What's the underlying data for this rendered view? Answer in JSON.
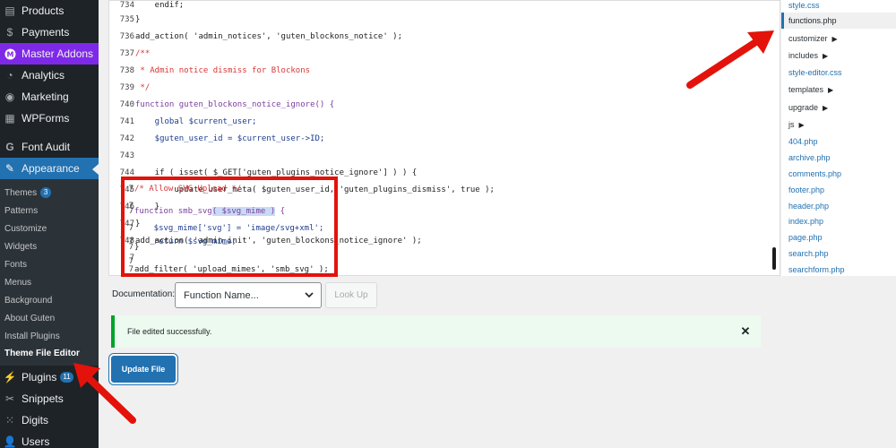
{
  "sidebar": {
    "top_items": [
      {
        "label": "Products",
        "icon": "products-icon"
      },
      {
        "label": "Payments",
        "icon": "payments-icon"
      },
      {
        "label": "Master Addons",
        "icon": "master-addons-icon"
      },
      {
        "label": "Analytics",
        "icon": "analytics-icon"
      },
      {
        "label": "Marketing",
        "icon": "marketing-icon"
      },
      {
        "label": "WPForms",
        "icon": "wpforms-icon"
      },
      {
        "label": "Font Audit",
        "icon": "font-audit-icon"
      },
      {
        "label": "Appearance",
        "icon": "appearance-icon"
      }
    ],
    "appearance_sub": [
      {
        "label": "Themes",
        "badge": "3"
      },
      {
        "label": "Patterns"
      },
      {
        "label": "Customize"
      },
      {
        "label": "Widgets"
      },
      {
        "label": "Fonts"
      },
      {
        "label": "Menus"
      },
      {
        "label": "Background"
      },
      {
        "label": "About Guten"
      },
      {
        "label": "Install Plugins"
      },
      {
        "label": "Theme File Editor"
      }
    ],
    "bottom_items": [
      {
        "label": "Plugins",
        "icon": "plugins-icon",
        "badge": "11"
      },
      {
        "label": "Snippets",
        "icon": "snippets-icon"
      },
      {
        "label": "Digits",
        "icon": "digits-icon"
      },
      {
        "label": "Users",
        "icon": "users-icon"
      }
    ]
  },
  "editor": {
    "lines": [
      {
        "n": "734",
        "t": "    endif;"
      },
      {
        "n": "735",
        "t": "}"
      },
      {
        "n": "736",
        "t": "add_action( 'admin_notices', 'guten_blockons_notice' );"
      },
      {
        "n": "737",
        "t": "/**"
      },
      {
        "n": "738",
        "t": " * Admin notice dismiss for Blockons"
      },
      {
        "n": "739",
        "t": " */"
      },
      {
        "n": "740",
        "t": "function guten_blockons_notice_ignore() {"
      },
      {
        "n": "741",
        "t": "    global $current_user;"
      },
      {
        "n": "742",
        "t": "    $guten_user_id = $current_user->ID;"
      },
      {
        "n": "743",
        "t": ""
      },
      {
        "n": "744",
        "t": "    if ( isset( $_GET['guten_plugins_notice_ignore'] ) ) {"
      },
      {
        "n": "745",
        "t": "        update_user_meta( $guten_user_id, 'guten_plugins_dismiss', true );"
      },
      {
        "n": "746",
        "t": "    }"
      },
      {
        "n": "747",
        "t": "}"
      },
      {
        "n": "748",
        "t": "add_action( 'admin_init', 'guten_blockons_notice_ignore' );"
      },
      {
        "n": "7",
        "t": ""
      },
      {
        "n": "7",
        "t": "/* Allow SVG Upload */"
      },
      {
        "n": "7",
        "t": ""
      },
      {
        "n": "7",
        "t": "function smb_svg( $svg_mime ) {"
      },
      {
        "n": "7",
        "t": "    $svg_mime['svg'] = 'image/svg+xml';"
      },
      {
        "n": "7",
        "t": "    return $svg_mime;"
      },
      {
        "n": "7",
        "t": "}"
      },
      {
        "n": "7",
        "t": ""
      },
      {
        "n": "7",
        "t": "add_filter( 'upload_mimes', 'smb_svg' );"
      }
    ]
  },
  "files": [
    {
      "label": "style.css",
      "type": "file"
    },
    {
      "label": "functions.php",
      "type": "file",
      "current": true
    },
    {
      "label": "customizer",
      "type": "folder"
    },
    {
      "label": "includes",
      "type": "folder"
    },
    {
      "label": "style-editor.css",
      "type": "file"
    },
    {
      "label": "templates",
      "type": "folder"
    },
    {
      "label": "upgrade",
      "type": "folder"
    },
    {
      "label": "js",
      "type": "folder"
    },
    {
      "label": "404.php",
      "type": "file"
    },
    {
      "label": "archive.php",
      "type": "file"
    },
    {
      "label": "comments.php",
      "type": "file"
    },
    {
      "label": "footer.php",
      "type": "file"
    },
    {
      "label": "header.php",
      "type": "file"
    },
    {
      "label": "index.php",
      "type": "file"
    },
    {
      "label": "page.php",
      "type": "file"
    },
    {
      "label": "search.php",
      "type": "file"
    },
    {
      "label": "searchform.php",
      "type": "file"
    }
  ],
  "documentation": {
    "label": "Documentation:",
    "select_value": "Function Name...",
    "lookup_label": "Look Up"
  },
  "notice": {
    "message": "File edited successfully.",
    "close": "✕"
  },
  "update_button": "Update File",
  "colors": {
    "sidebar_bg": "#1d2327",
    "accent": "#2271b1",
    "master_addons": "#7f29e8",
    "annotation_red": "#e3120b",
    "notice_green": "#00a32a"
  }
}
